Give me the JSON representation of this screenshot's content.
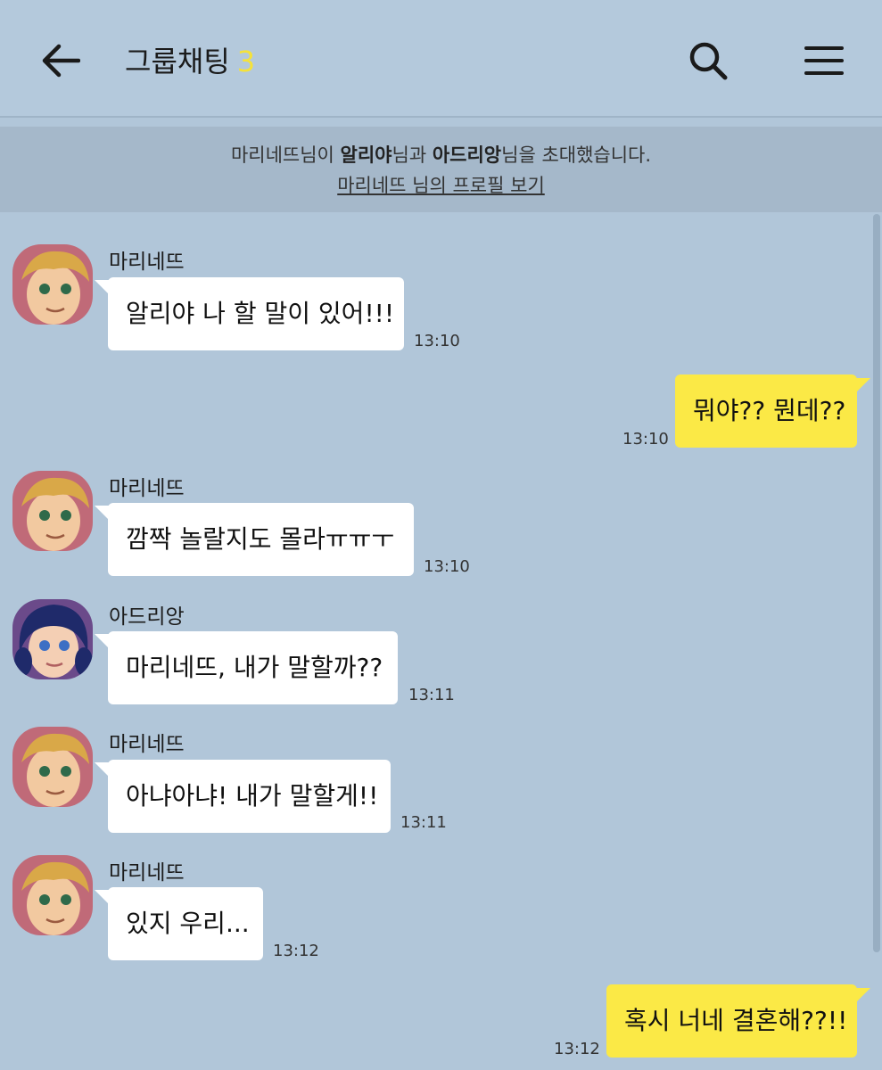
{
  "header": {
    "title": "그룹채팅",
    "member_count": "3",
    "icons": {
      "back": "arrow-left-icon",
      "search": "search-icon",
      "menu": "hamburger-menu-icon"
    }
  },
  "notice": {
    "invite_actor": "마리네뜨",
    "invite_text_1": "님이 ",
    "invite_target_1": "알리야",
    "invite_text_2": "님과 ",
    "invite_target_2": "아드리앙",
    "invite_text_3": "님을 초대했습니다.",
    "profile_link": "마리네뜨 님의 프로필 보기"
  },
  "messages": [
    {
      "side": "in",
      "sender": "마리네뜨",
      "text": "알리야 나 할 말이 있어!!!",
      "time": "13:10"
    },
    {
      "side": "out",
      "text": "뭐야?? 뭔데??",
      "time": "13:10"
    },
    {
      "side": "in",
      "sender": "마리네뜨",
      "text": "깜짝 놀랄지도 몰라ㅠㅠㅜ",
      "time": "13:10"
    },
    {
      "side": "in",
      "sender": "아드리앙",
      "text": "마리네뜨, 내가 말할까??",
      "time": "13:11"
    },
    {
      "side": "in",
      "sender": "마리네뜨",
      "text": "아냐아냐! 내가 말할게!!",
      "time": "13:11"
    },
    {
      "side": "in",
      "sender": "마리네뜨",
      "text": "있지 우리...",
      "time": "13:12"
    },
    {
      "side": "out",
      "text": "혹시 너네 결혼해??!!",
      "time": "13:12"
    }
  ],
  "colors": {
    "background": "#b1c6d9",
    "outgoing_bubble": "#fbe946",
    "incoming_bubble": "#ffffff",
    "member_count": "#f5e23a"
  }
}
